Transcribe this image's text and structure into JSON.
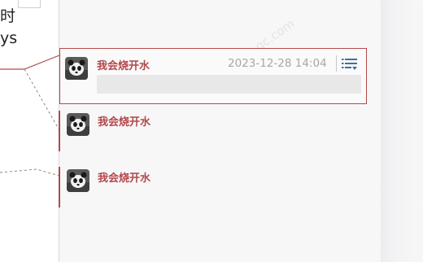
{
  "document": {
    "line1": "时",
    "line2": "ys"
  },
  "comments": [
    {
      "author": "我会烧开水",
      "timestamp": "2023-12-28 14:04",
      "reply_placeholder": "",
      "active": true
    },
    {
      "author": "我会烧开水",
      "active": false
    },
    {
      "author": "我会烧开水",
      "active": false
    }
  ],
  "icons": {
    "menu": "comment-menu-icon",
    "avatar": "panda-avatar-icon"
  },
  "colors": {
    "accent": "#b3484a",
    "timestamp": "#a7a7a7",
    "pane_background": "#f7f7f8",
    "reply_box": "#e8e8e8"
  },
  "watermark": "www.cr...gc.com"
}
